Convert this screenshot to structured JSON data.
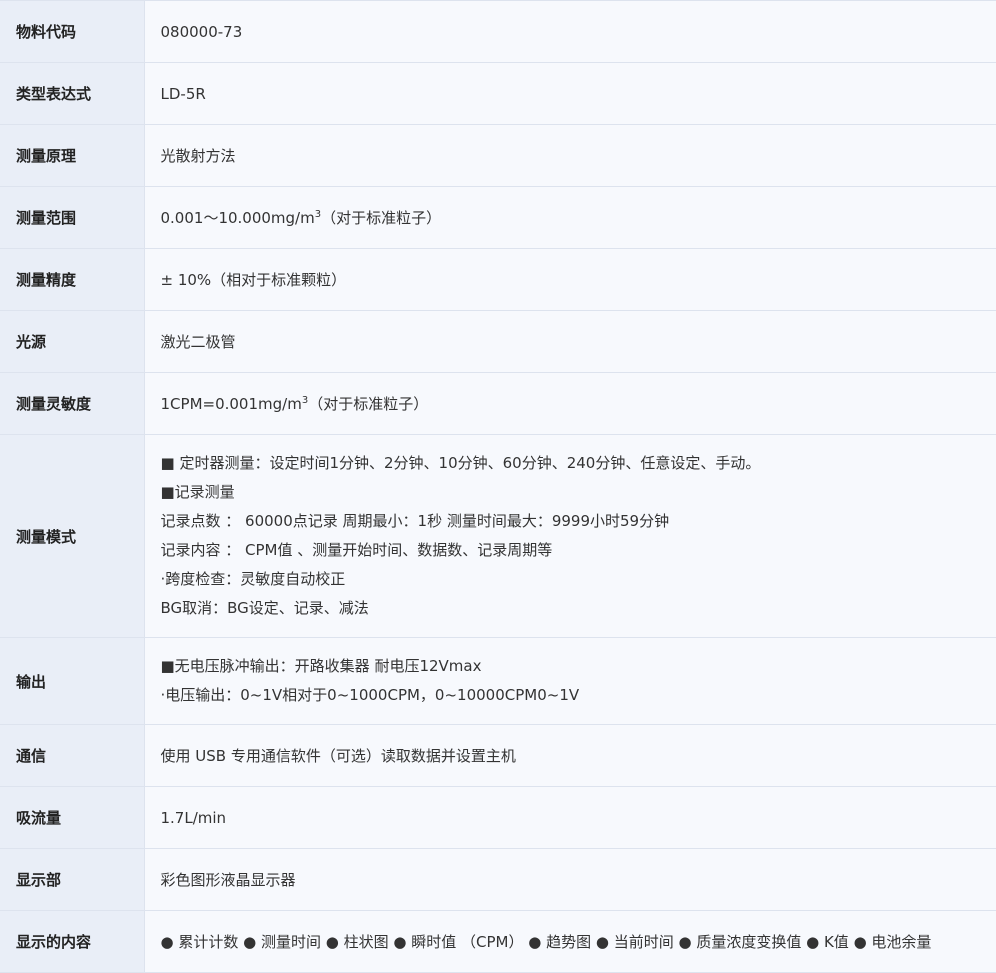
{
  "rows": [
    {
      "label": "物料代码",
      "value": "080000-73"
    },
    {
      "label": "类型表达式",
      "value": "LD-5R"
    },
    {
      "label": "测量原理",
      "value": "光散射方法"
    },
    {
      "label": "测量范围",
      "value_pre": "0.001～10.000mg/m",
      "value_sup": "3",
      "value_post": "（对于标准粒子）"
    },
    {
      "label": "测量精度",
      "value": "± 10%（相对于标准颗粒）"
    },
    {
      "label": "光源",
      "value": "激光二极管"
    },
    {
      "label": "测量灵敏度",
      "value_pre": "1CPM=0.001mg/m",
      "value_sup": "3",
      "value_post": "（对于标准粒子）"
    },
    {
      "label": "测量模式",
      "lines": [
        "■ 定时器测量：设定时间1分钟、2分钟、10分钟、60分钟、240分钟、任意设定、手动。",
        "■记录测量",
        "记录点数 ： 60000点记录 周期最小：1秒 测量时间最大：9999小时59分钟",
        "记录内容 ： CPM值 、测量开始时间、数据数、记录周期等",
        "·跨度检查：灵敏度自动校正",
        "BG取消：BG设定、记录、减法"
      ]
    },
    {
      "label": "输出",
      "lines": [
        "■无电压脉冲输出：开路收集器 耐电压12Vmax",
        "·电压输出：0~1V相对于0~1000CPM，0~10000CPM0~1V"
      ]
    },
    {
      "label": "通信",
      "value": "使用 USB 专用通信软件（可选）读取数据并设置主机"
    },
    {
      "label": "吸流量",
      "value": "1.7L/min"
    },
    {
      "label": "显示部",
      "value": "彩色图形液晶显示器"
    },
    {
      "label": "显示的内容",
      "value": "● 累计计数 ● 测量时间 ● 柱状图 ● 瞬时值 （CPM） ● 趋势图 ● 当前时间 ● 质量浓度变换值 ● K值 ● 电池余量"
    }
  ]
}
